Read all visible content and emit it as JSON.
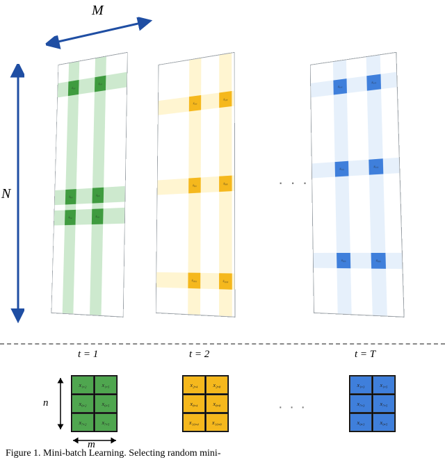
{
  "labels": {
    "M": "M",
    "N": "N",
    "n": "n",
    "m": "m",
    "ellipsis": "· · ·",
    "t1": "t = 1",
    "t2": "t = 2",
    "tT": "t = T"
  },
  "caption_text": "Figure 1.  Mini-batch Learning.  Selecting random mini-",
  "panel_green": {
    "rows": [
      1,
      6,
      7
    ],
    "cols": [
      2,
      5
    ],
    "cells": [
      "x₁,₂",
      "x₁,₅",
      "x₆,₂",
      "x₆,₅",
      "x₇,₂",
      "x₇,₅"
    ],
    "mini": [
      "x₁,₂",
      "x₁,₅",
      "x₆,₂",
      "x₆,₅",
      "x₇,₂",
      "x₇,₅"
    ]
  },
  "panel_yellow": {
    "rows": [
      2,
      8,
      10
    ],
    "cols": [
      4,
      8
    ],
    "cells": [
      "x₂,₄",
      "x₂,₈",
      "x₈,₄",
      "x₈,₈",
      "x₁₀,₄",
      "x₁₀,₈"
    ],
    "mini": [
      "x₂,₄",
      "x₂,₈",
      "x₈,₄",
      "x₈,₈",
      "x₁₀,₄",
      "x₁₀,₈"
    ]
  },
  "panel_blue": {
    "rows": [
      1,
      7,
      9
    ],
    "cols": [
      3,
      5
    ],
    "cells": [
      "x₁,₃",
      "x₁,₅",
      "x₇,₃",
      "x₇,₅",
      "x₉,₃",
      "x₉,₅"
    ],
    "mini": [
      "x₁,₃",
      "x₁,₅",
      "x₇,₃",
      "x₇,₅",
      "x₉,₃",
      "x₉,₅"
    ]
  }
}
